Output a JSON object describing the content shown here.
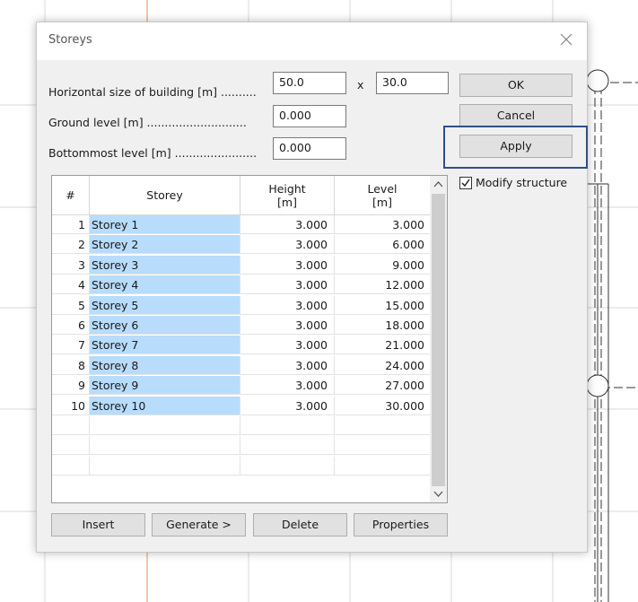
{
  "dialog": {
    "title": "Storeys",
    "fields": {
      "horizontal_label": "Horizontal size of building [m] ..........",
      "horizontal_x": "50.0",
      "x_separator": "x",
      "horizontal_y": "30.0",
      "ground_label": "Ground level [m] ............................",
      "ground_value": "0.000",
      "bottom_label": "Bottommost level [m] .......................",
      "bottom_value": "0.000"
    },
    "buttons": {
      "ok": "OK",
      "cancel": "Cancel",
      "apply": "Apply",
      "insert": "Insert",
      "generate": "Generate >",
      "delete": "Delete",
      "properties": "Properties"
    },
    "modify_structure": {
      "label": "Modify structure",
      "checked": true
    },
    "table": {
      "headers": {
        "num": "#",
        "storey": "Storey",
        "height": "Height",
        "height_unit": "[m]",
        "level": "Level",
        "level_unit": "[m]"
      },
      "rows": [
        {
          "num": "1",
          "name": "Storey 1",
          "height": "3.000",
          "level": "3.000"
        },
        {
          "num": "2",
          "name": "Storey 2",
          "height": "3.000",
          "level": "6.000"
        },
        {
          "num": "3",
          "name": "Storey 3",
          "height": "3.000",
          "level": "9.000"
        },
        {
          "num": "4",
          "name": "Storey 4",
          "height": "3.000",
          "level": "12.000"
        },
        {
          "num": "5",
          "name": "Storey 5",
          "height": "3.000",
          "level": "15.000"
        },
        {
          "num": "6",
          "name": "Storey 6",
          "height": "3.000",
          "level": "18.000"
        },
        {
          "num": "7",
          "name": "Storey 7",
          "height": "3.000",
          "level": "21.000"
        },
        {
          "num": "8",
          "name": "Storey 8",
          "height": "3.000",
          "level": "24.000"
        },
        {
          "num": "9",
          "name": "Storey 9",
          "height": "3.000",
          "level": "27.000"
        },
        {
          "num": "10",
          "name": "Storey 10",
          "height": "3.000",
          "level": "30.000"
        }
      ],
      "empty_rows": 3
    }
  },
  "colors": {
    "selection": "#b8dcfc",
    "focus_ring": "#2f4f86",
    "grid_lines": "#d8d8d8",
    "axis_orange": "#f0a070"
  }
}
